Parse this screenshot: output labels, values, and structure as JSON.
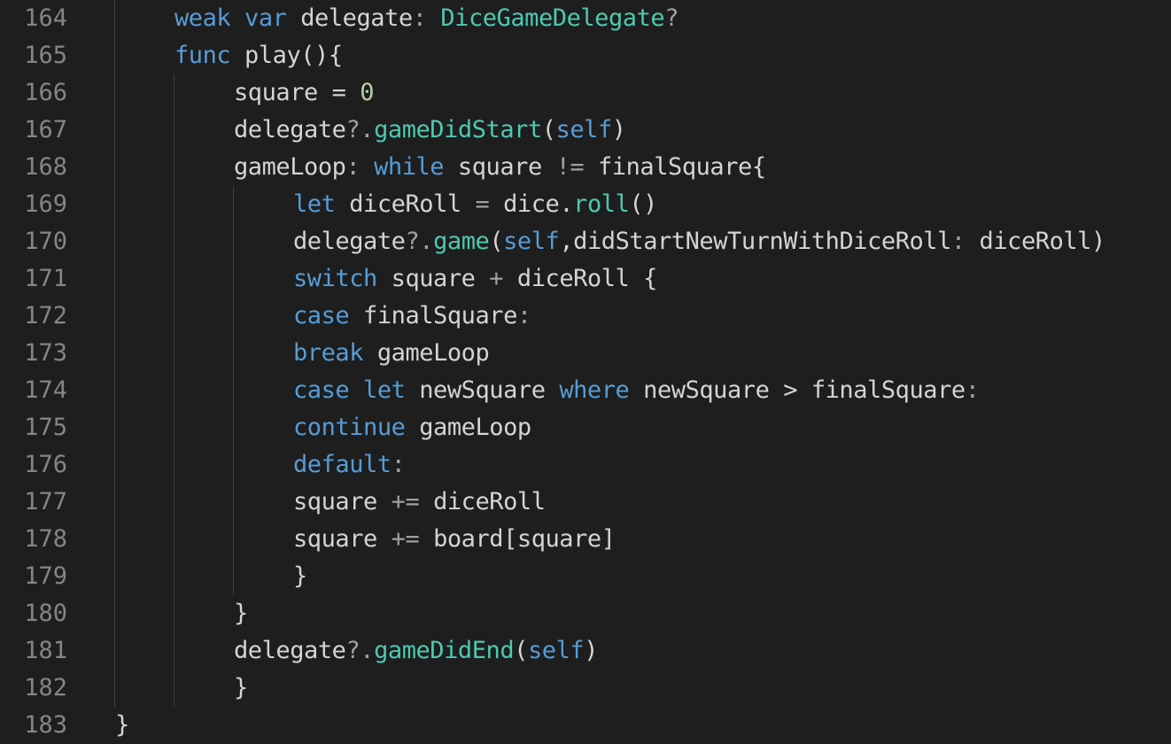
{
  "editor": {
    "background": "#1e1e1e",
    "colors": {
      "plain": "#d4d4d4",
      "keyword": "#569cd6",
      "type": "#4ec9b0",
      "function": "#4ec9b0",
      "number": "#b5cea8",
      "punctuation": "#a0a0a0",
      "line_number": "#858585",
      "indent_guide": "#404040"
    },
    "lines": [
      {
        "number": "164",
        "indent": 2,
        "tokens": [
          {
            "t": "weak var ",
            "k": "keyword"
          },
          {
            "t": "delegate",
            "k": "plain"
          },
          {
            "t": ": ",
            "k": "punct"
          },
          {
            "t": "DiceGameDelegate",
            "k": "type"
          },
          {
            "t": "?",
            "k": "punct"
          }
        ]
      },
      {
        "number": "165",
        "indent": 2,
        "tokens": [
          {
            "t": "func ",
            "k": "keyword"
          },
          {
            "t": "play(){",
            "k": "plain"
          }
        ]
      },
      {
        "number": "166",
        "indent": 3,
        "tokens": [
          {
            "t": "square = ",
            "k": "plain"
          },
          {
            "t": "0",
            "k": "number"
          }
        ]
      },
      {
        "number": "167",
        "indent": 3,
        "tokens": [
          {
            "t": "delegate",
            "k": "plain"
          },
          {
            "t": "?.",
            "k": "punct"
          },
          {
            "t": "gameDidStart",
            "k": "func"
          },
          {
            "t": "(",
            "k": "plain"
          },
          {
            "t": "self",
            "k": "keyword"
          },
          {
            "t": ")",
            "k": "plain"
          }
        ]
      },
      {
        "number": "168",
        "indent": 3,
        "tokens": [
          {
            "t": "gameLoop",
            "k": "plain"
          },
          {
            "t": ": ",
            "k": "punct"
          },
          {
            "t": "while ",
            "k": "keyword"
          },
          {
            "t": "square ",
            "k": "plain"
          },
          {
            "t": "!= ",
            "k": "punct"
          },
          {
            "t": "finalSquare{",
            "k": "plain"
          }
        ]
      },
      {
        "number": "169",
        "indent": 4,
        "tokens": [
          {
            "t": "let ",
            "k": "keyword"
          },
          {
            "t": "diceRoll ",
            "k": "plain"
          },
          {
            "t": "= ",
            "k": "punct"
          },
          {
            "t": "dice.",
            "k": "plain"
          },
          {
            "t": "roll",
            "k": "func"
          },
          {
            "t": "()",
            "k": "plain"
          }
        ]
      },
      {
        "number": "170",
        "indent": 4,
        "tokens": [
          {
            "t": "delegate",
            "k": "plain"
          },
          {
            "t": "?.",
            "k": "punct"
          },
          {
            "t": "game",
            "k": "func"
          },
          {
            "t": "(",
            "k": "plain"
          },
          {
            "t": "self",
            "k": "keyword"
          },
          {
            "t": ",didStartNewTurnWithDiceRoll",
            "k": "plain"
          },
          {
            "t": ": ",
            "k": "punct"
          },
          {
            "t": "diceRoll)",
            "k": "plain"
          }
        ]
      },
      {
        "number": "171",
        "indent": 4,
        "tokens": [
          {
            "t": "switch ",
            "k": "keyword"
          },
          {
            "t": "square ",
            "k": "plain"
          },
          {
            "t": "+ ",
            "k": "punct"
          },
          {
            "t": "diceRoll {",
            "k": "plain"
          }
        ]
      },
      {
        "number": "172",
        "indent": 4,
        "tokens": [
          {
            "t": "case ",
            "k": "keyword"
          },
          {
            "t": "finalSquare",
            "k": "plain"
          },
          {
            "t": ":",
            "k": "punct"
          }
        ]
      },
      {
        "number": "173",
        "indent": 4,
        "tokens": [
          {
            "t": "break ",
            "k": "keyword"
          },
          {
            "t": "gameLoop",
            "k": "plain"
          }
        ]
      },
      {
        "number": "174",
        "indent": 4,
        "tokens": [
          {
            "t": "case let ",
            "k": "keyword"
          },
          {
            "t": "newSquare ",
            "k": "plain"
          },
          {
            "t": "where ",
            "k": "keyword"
          },
          {
            "t": "newSquare > finalSquare",
            "k": "plain"
          },
          {
            "t": ":",
            "k": "punct"
          }
        ]
      },
      {
        "number": "175",
        "indent": 4,
        "tokens": [
          {
            "t": "continue ",
            "k": "keyword"
          },
          {
            "t": "gameLoop",
            "k": "plain"
          }
        ]
      },
      {
        "number": "176",
        "indent": 4,
        "tokens": [
          {
            "t": "default",
            "k": "keyword"
          },
          {
            "t": ":",
            "k": "punct"
          }
        ]
      },
      {
        "number": "177",
        "indent": 4,
        "tokens": [
          {
            "t": "square ",
            "k": "plain"
          },
          {
            "t": "+= ",
            "k": "punct"
          },
          {
            "t": "diceRoll",
            "k": "plain"
          }
        ]
      },
      {
        "number": "178",
        "indent": 4,
        "tokens": [
          {
            "t": "square ",
            "k": "plain"
          },
          {
            "t": "+= ",
            "k": "punct"
          },
          {
            "t": "board[square]",
            "k": "plain"
          }
        ]
      },
      {
        "number": "179",
        "indent": 4,
        "tokens": [
          {
            "t": "}",
            "k": "plain"
          }
        ]
      },
      {
        "number": "180",
        "indent": 3,
        "tokens": [
          {
            "t": "}",
            "k": "plain"
          }
        ]
      },
      {
        "number": "181",
        "indent": 3,
        "tokens": [
          {
            "t": "delegate",
            "k": "plain"
          },
          {
            "t": "?.",
            "k": "punct"
          },
          {
            "t": "gameDidEnd",
            "k": "func"
          },
          {
            "t": "(",
            "k": "plain"
          },
          {
            "t": "self",
            "k": "keyword"
          },
          {
            "t": ")",
            "k": "plain"
          }
        ]
      },
      {
        "number": "182",
        "indent": 3,
        "tokens": [
          {
            "t": "}",
            "k": "plain"
          }
        ]
      },
      {
        "number": "183",
        "indent": 1,
        "tokens": [
          {
            "t": "}",
            "k": "plain"
          }
        ]
      }
    ]
  }
}
